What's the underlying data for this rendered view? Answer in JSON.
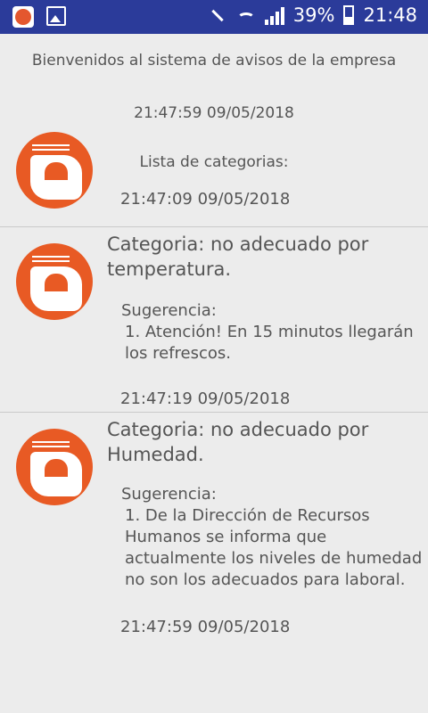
{
  "status_bar": {
    "battery": "39%",
    "time": "21:48"
  },
  "header": {
    "welcome": "Bienvenidos al sistema de avisos de la empresa",
    "timestamp": "21:47:59 09/05/2018",
    "list_title": "Lista de categorias:"
  },
  "notices": [
    {
      "timestamp": "21:47:09 09/05/2018"
    },
    {
      "category": "Categoria: no adecuado por temperatura.",
      "suggestion_label": "Sugerencia:",
      "suggestion": "1. Atención! En 15 minutos llegarán los refrescos.",
      "timestamp": "21:47:19 09/05/2018"
    },
    {
      "category": "Categoria: no adecuado por Humedad.",
      "suggestion_label": "Sugerencia:",
      "suggestion": "1. De la Dirección de Recursos Humanos se informa que actualmente los niveles de humedad no son los adecuados para laboral.",
      "timestamp": "21:47:59 09/05/2018"
    }
  ],
  "colors": {
    "status_bar": "#2b3b9a",
    "background": "#ececec",
    "icon_orange": "#e85a24"
  }
}
